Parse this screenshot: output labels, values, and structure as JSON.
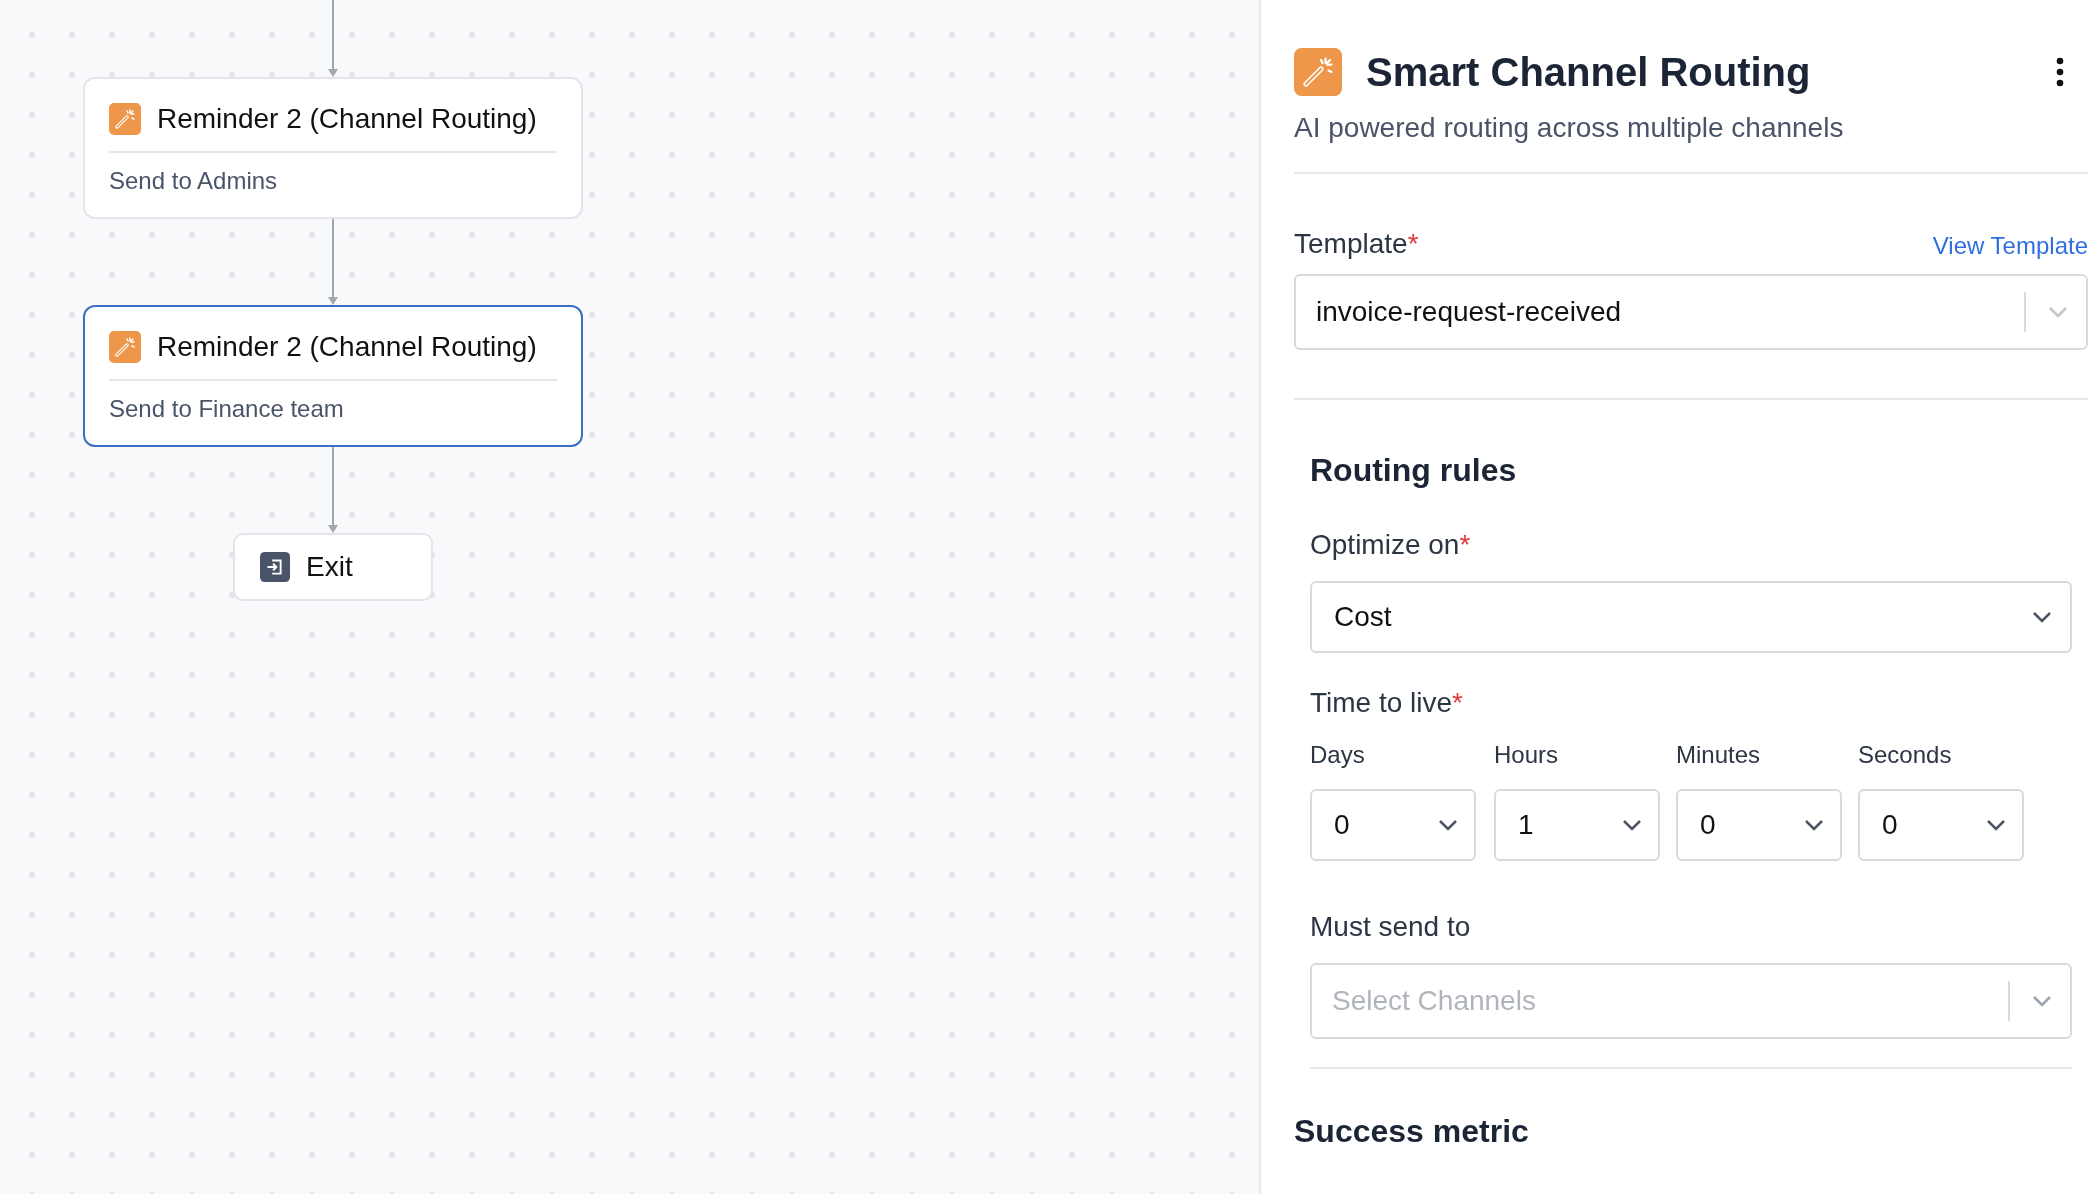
{
  "canvas": {
    "nodes": [
      {
        "kind": "step",
        "title": "Reminder 2 (Channel Routing)",
        "subtitle": "Send to Admins",
        "selected": false
      },
      {
        "kind": "step",
        "title": "Reminder 2 (Channel Routing)",
        "subtitle": "Send to Finance team",
        "selected": true
      },
      {
        "kind": "exit",
        "title": "Exit"
      }
    ]
  },
  "panel": {
    "title": "Smart Channel Routing",
    "subtitle": "AI powered routing across multiple channels",
    "template": {
      "label": "Template",
      "required_mark": "*",
      "link": "View Template",
      "value": "invoice-request-received"
    },
    "routing_rules": {
      "heading": "Routing rules",
      "optimize_on": {
        "label": "Optimize on",
        "required_mark": "*",
        "value": "Cost"
      },
      "time_to_live": {
        "label": "Time to live",
        "required_mark": "*",
        "fields": [
          {
            "label": "Days",
            "value": "0"
          },
          {
            "label": "Hours",
            "value": "1"
          },
          {
            "label": "Minutes",
            "value": "0"
          },
          {
            "label": "Seconds",
            "value": "0"
          }
        ]
      },
      "must_send_to": {
        "label": "Must send to",
        "placeholder": "Select Channels"
      }
    },
    "next_section": "Success metric"
  }
}
